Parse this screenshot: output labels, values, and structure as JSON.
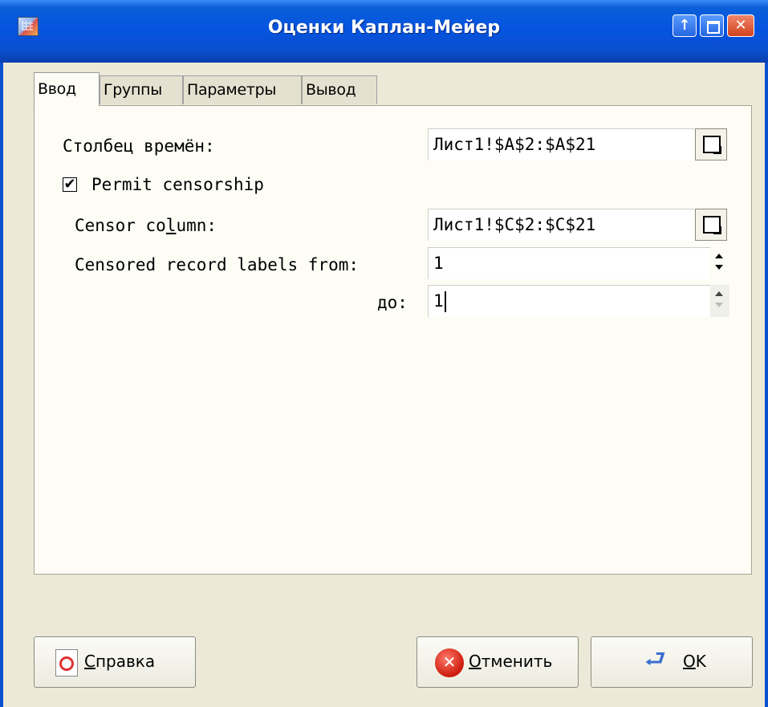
{
  "window": {
    "title": "Оценки Каплан-Мейер",
    "buttons": {
      "up": "↑",
      "close": "✕"
    }
  },
  "tabs": [
    {
      "label": "Ввод",
      "active": true
    },
    {
      "label": "Группы",
      "active": false
    },
    {
      "label": "Параметры",
      "active": false
    },
    {
      "label": "Вывод",
      "active": false
    }
  ],
  "input_tab": {
    "times_label": "Столбец времён:",
    "times_value": "Лист1!$A$2:$A$21",
    "permit_censorship_label": "Permit censorship",
    "permit_censorship_checked": true,
    "check_mark": "✔",
    "censor_column_label_pre": "Censor co",
    "censor_column_label_mnemonic": "l",
    "censor_column_label_post": "umn:",
    "censor_column_value": "Лист1!$C$2:$C$21",
    "censored_from_label": "Censored record labels from:",
    "censored_from_value": "1",
    "censored_to_label": "до:",
    "censored_to_value": "1"
  },
  "buttons": {
    "help_mnemonic": "С",
    "help_rest": "правка",
    "cancel_mnemonic": "О",
    "cancel_rest": "тменить",
    "cancel_icon": "✕",
    "ok_mnemonic": "O",
    "ok_rest": "K",
    "ok_icon": "⮐"
  }
}
